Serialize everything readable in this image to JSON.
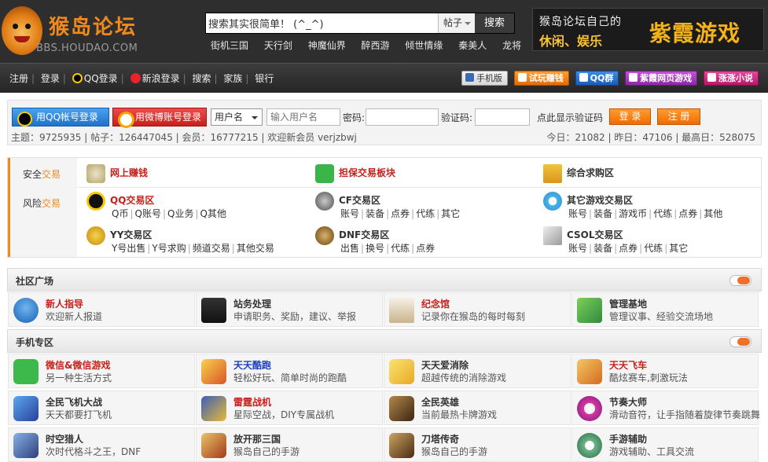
{
  "header": {
    "logo_title": "猴岛论坛",
    "logo_url": "BBS.HOUDAO.COM",
    "search_placeholder": "搜索其实很简单！ (^_^)",
    "search_type": "帖子",
    "search_button": "搜索",
    "hot_links": [
      "街机三国",
      "天行剑",
      "神魔仙界",
      "醉西游",
      "倾世情缘",
      "秦美人",
      "龙将"
    ],
    "banner": {
      "line1": "猴岛论坛自己的",
      "line2": "休闲、娱乐",
      "brand": "紫霞游戏"
    }
  },
  "nav": {
    "left": [
      "注册",
      "登录",
      "QQ登录",
      "新浪登录",
      "搜索",
      "家族",
      "银行"
    ],
    "right": [
      "手机版",
      "试玩赚钱",
      "QQ群",
      "紫霞网页游戏",
      "涨涨小说"
    ]
  },
  "login": {
    "qq_button": "用QQ帐号登录",
    "weibo_button": "用微博账号登录",
    "user_type": "用户名",
    "user_placeholder": "输入用户名",
    "password_label": "密码:",
    "captcha_label": "验证码:",
    "show_captcha": "点此显示验证码",
    "login_button": "登 录",
    "register_button": "注 册",
    "stats_left": "主题：9725935 | 帖子：126447045 | 会员：16777215 | 欢迎新会员 verjzbwj",
    "stats_right": "今日：21082 | 昨日：47106 | 最高日：528075"
  },
  "trade": {
    "side_safe": {
      "a": "安全",
      "b": "交易"
    },
    "side_risk": {
      "a": "风险",
      "b": "交易"
    },
    "items": [
      {
        "title": "网上赚钱",
        "subs": []
      },
      {
        "title": "担保交易板块",
        "subs": []
      },
      {
        "title": "综合求购区",
        "subs": []
      },
      {
        "title": "QQ交易区",
        "subs": [
          "Q币",
          "Q账号",
          "Q业务",
          "Q其他"
        ]
      },
      {
        "title": "CF交易区",
        "subs": [
          "账号",
          "装备",
          "点券",
          "代练",
          "其它"
        ]
      },
      {
        "title": "其它游戏交易区",
        "subs": [
          "账号",
          "装备",
          "游戏币",
          "代练",
          "点券",
          "其他"
        ]
      },
      {
        "title": "YY交易区",
        "subs": [
          "Y号出售",
          "Y号求购",
          "频道交易",
          "其他交易"
        ]
      },
      {
        "title": "DNF交易区",
        "subs": [
          "出售",
          "换号",
          "代练",
          "点券"
        ]
      },
      {
        "title": "CSOL交易区",
        "subs": [
          "账号",
          "装备",
          "点券",
          "代练",
          "其它"
        ]
      }
    ]
  },
  "community": {
    "title": "社区广场",
    "items": [
      {
        "title": "新人指导",
        "desc": "欢迎新人报道"
      },
      {
        "title": "站务处理",
        "desc": "申请职务、奖励，建议、举报"
      },
      {
        "title": "纪念馆",
        "desc": "记录你在猴岛的每时每刻"
      },
      {
        "title": "管理基地",
        "desc": "管理议事、经验交流场地"
      }
    ]
  },
  "mobile": {
    "title": "手机专区",
    "items": [
      {
        "title": "微信&微信游戏",
        "desc": "另一种生活方式"
      },
      {
        "title": "天天酷跑",
        "desc": "轻松好玩、简单时尚的跑酷"
      },
      {
        "title": "天天爱消除",
        "desc": "超越传统的消除游戏"
      },
      {
        "title": "天天飞车",
        "desc": "酷炫赛车,刺激玩法"
      },
      {
        "title": "全民飞机大战",
        "desc": "天天都要打飞机"
      },
      {
        "title": "雷霆战机",
        "desc": "星际空战，DIY专属战机"
      },
      {
        "title": "全民英雄",
        "desc": "当前最热卡牌游戏"
      },
      {
        "title": "节奏大师",
        "desc": "滑动音符，让手指随着旋律节奏跳舞"
      },
      {
        "title": "时空猎人",
        "desc": "次时代格斗之王，DNF"
      },
      {
        "title": "放开那三国",
        "desc": "猴岛自己的手游"
      },
      {
        "title": "刀塔传奇",
        "desc": "猴岛自己的手游"
      },
      {
        "title": "手游辅助",
        "desc": "游戏辅助、工具交流"
      }
    ]
  }
}
